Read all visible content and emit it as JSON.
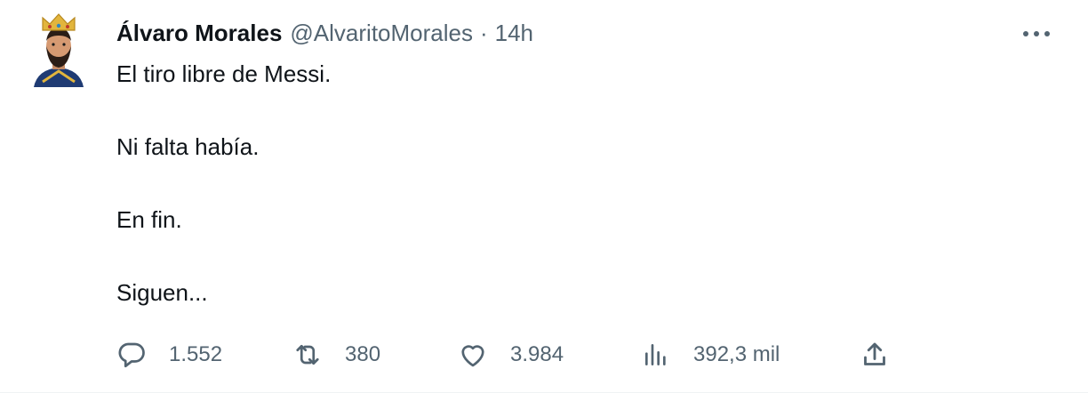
{
  "tweet": {
    "author_name": "Álvaro Morales",
    "handle": "@AlvaritoMorales",
    "separator": "·",
    "time": "14h",
    "lines": [
      "El tiro libre de Messi.",
      "Ni falta había.",
      "En fin.",
      "Siguen..."
    ],
    "actions": {
      "replies": "1.552",
      "retweets": "380",
      "likes": "3.984",
      "views": "392,3 mil"
    }
  },
  "icons": {
    "more": "more-dots-icon",
    "reply": "reply-bubble-icon",
    "retweet": "retweet-icon",
    "like": "heart-icon",
    "views": "analytics-bars-icon",
    "share": "share-upload-icon"
  },
  "colors": {
    "text": "#0f1419",
    "secondary": "#536471",
    "crown": "#e2b53d"
  }
}
